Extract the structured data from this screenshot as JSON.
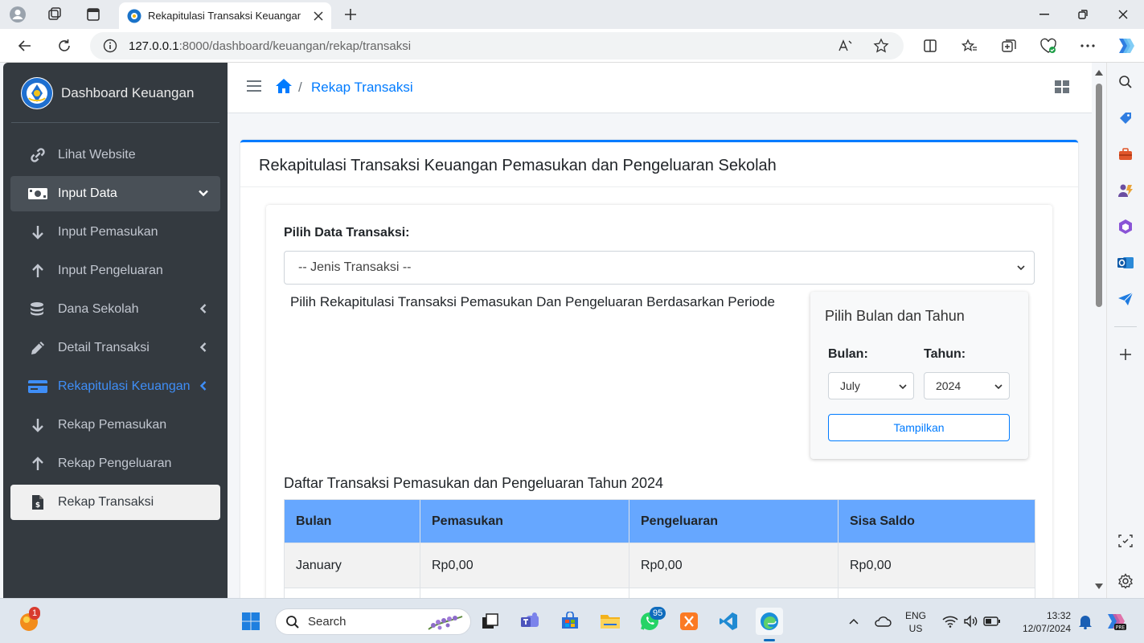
{
  "browser": {
    "tab_title": "Rekapitulasi Transaksi Keuangan",
    "url_host": "127.0.0.1",
    "url_path": ":8000/dashboard/keuangan/rekap/transaksi"
  },
  "sidebar": {
    "brand": "Dashboard Keuangan",
    "items": [
      {
        "label": "Lihat Website"
      },
      {
        "label": "Input Data"
      },
      {
        "label": "Input Pemasukan"
      },
      {
        "label": "Input Pengeluaran"
      },
      {
        "label": "Dana Sekolah"
      },
      {
        "label": "Detail Transaksi"
      },
      {
        "label": "Rekapitulasi Keuangan"
      },
      {
        "label": "Rekap Pemasukan"
      },
      {
        "label": "Rekap Pengeluaran"
      },
      {
        "label": "Rekap Transaksi"
      }
    ]
  },
  "header": {
    "breadcrumb_sep": "/",
    "breadcrumb_current": "Rekap Transaksi"
  },
  "card": {
    "title": "Rekapitulasi Transaksi Keuangan Pemasukan dan Pengeluaran Sekolah",
    "pilih_label": "Pilih Data Transaksi:",
    "jenis_select_value": "-- Jenis Transaksi --",
    "periode_text": "Pilih Rekapitulasi Transaksi Pemasukan Dan Pengeluaran Berdasarkan Periode",
    "period_box": {
      "title": "Pilih Bulan dan Tahun",
      "bulan_label": "Bulan:",
      "tahun_label": "Tahun:",
      "bulan_value": "July",
      "tahun_value": "2024",
      "button_label": "Tampilkan"
    },
    "table_title": "Daftar Transaksi Pemasukan dan Pengeluaran Tahun 2024",
    "table": {
      "headers": [
        "Bulan",
        "Pemasukan",
        "Pengeluaran",
        "Sisa Saldo"
      ],
      "rows": [
        [
          "January",
          "Rp0,00",
          "Rp0,00",
          "Rp0,00"
        ],
        [
          "",
          "",
          "",
          ""
        ]
      ]
    }
  },
  "taskbar": {
    "search_label": "Search",
    "whatsapp_badge": "95",
    "notification_badge": "1",
    "lang_line1": "ENG",
    "lang_line2": "US",
    "time": "13:32",
    "date": "12/07/2024"
  },
  "colors": {
    "sidebar_bg": "#343a40",
    "accent": "#007bff",
    "table_header": "#66a7ff"
  }
}
